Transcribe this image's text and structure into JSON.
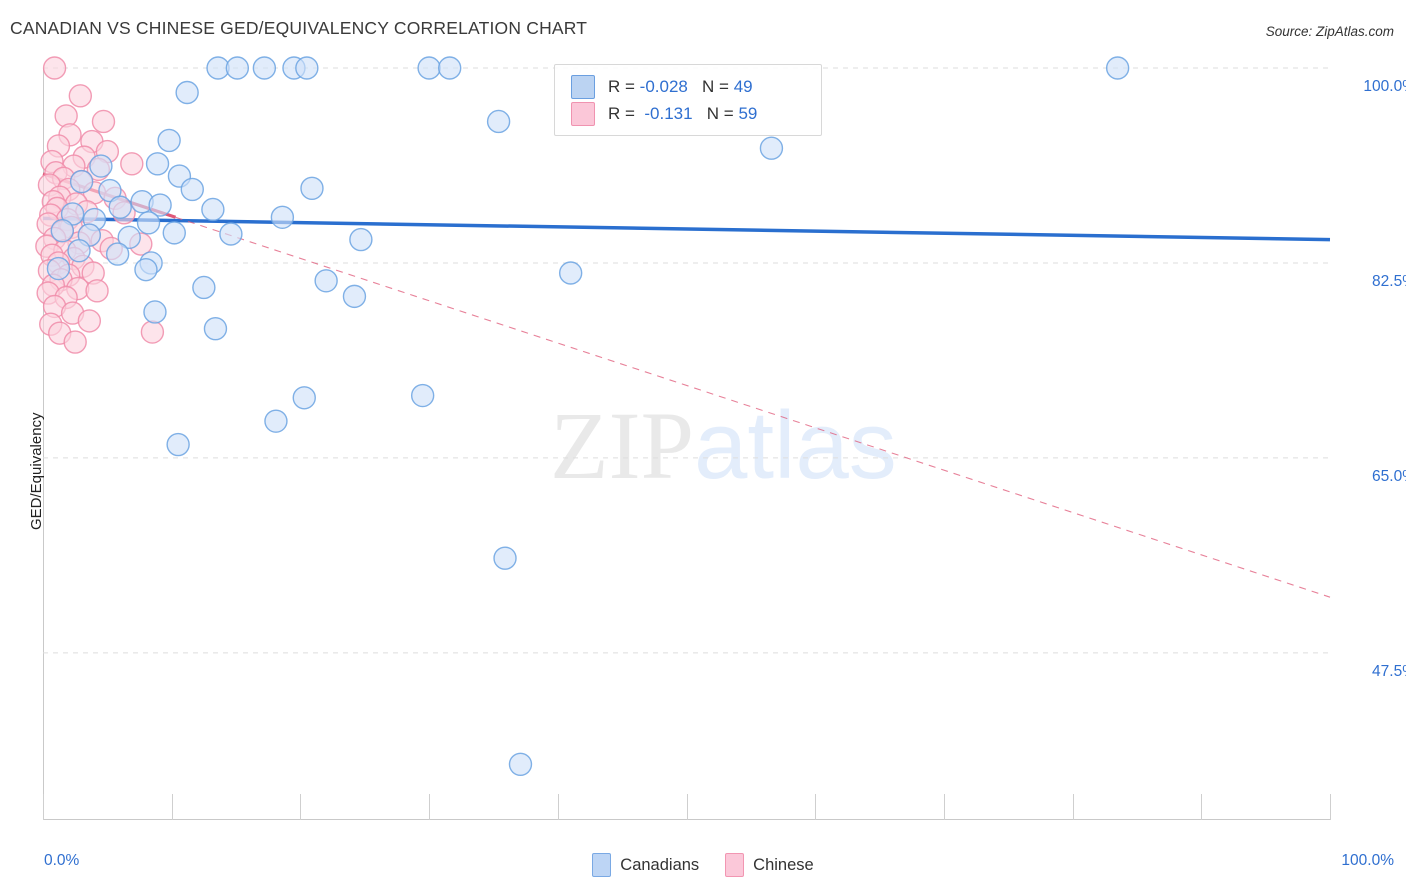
{
  "header": {
    "title": "CANADIAN VS CHINESE GED/EQUIVALENCY CORRELATION CHART",
    "source": "Source: ZipAtlas.com"
  },
  "watermark": {
    "part1": "ZIP",
    "part2": "atlas"
  },
  "axes": {
    "y_label": "GED/Equivalency",
    "y_ticks": [
      "100.0%",
      "82.5%",
      "65.0%",
      "47.5%"
    ],
    "x_min_label": "0.0%",
    "x_max_label": "100.0%"
  },
  "stats_legend": {
    "rows": [
      {
        "color": "#bbd3f2",
        "r_label": "R =",
        "r_value": "-0.028",
        "n_label": "N =",
        "n_value": "49"
      },
      {
        "color": "#fbc7d8",
        "r_label": "R =",
        "r_value": "-0.131",
        "n_label": "N =",
        "n_value": "59"
      }
    ]
  },
  "series_legend": [
    {
      "name": "Canadians",
      "color": "#bdd5f5"
    },
    {
      "name": "Chinese",
      "color": "#fbc8d9"
    }
  ],
  "colors": {
    "blue_fill": "#cfe0f8",
    "blue_stroke": "#6ba3e2",
    "pink_fill": "#fbd3de",
    "pink_stroke": "#f08ca9",
    "blue_trend": "#2a6fcf",
    "pink_trend": "#e05878",
    "axis_text": "#2f6fd0",
    "grid": "#dddddd"
  },
  "chart_data": {
    "type": "scatter",
    "title": "CANADIAN VS CHINESE GED/EQUIVALENCY CORRELATION CHART",
    "xlabel": "",
    "ylabel": "GED/Equivalency",
    "xlim": [
      0,
      100
    ],
    "ylim": [
      32.5,
      100
    ],
    "y_gridlines": [
      100.0,
      82.5,
      65.0,
      47.5
    ],
    "grid": true,
    "legend_position": "bottom-center",
    "series": [
      {
        "name": "Canadians",
        "color": "#cfe0f8",
        "R": -0.028,
        "N": 49,
        "trendline": {
          "style": "solid",
          "x0": 0,
          "y0": 86.5,
          "x1": 100,
          "y1": 84.6
        },
        "points": [
          [
            13.6,
            100.0
          ],
          [
            15.1,
            100.0
          ],
          [
            17.2,
            100.0
          ],
          [
            19.5,
            100.0
          ],
          [
            20.5,
            100.0
          ],
          [
            30.0,
            100.0
          ],
          [
            31.6,
            100.0
          ],
          [
            83.5,
            100.0
          ],
          [
            11.2,
            97.8
          ],
          [
            35.4,
            95.2
          ],
          [
            9.8,
            93.5
          ],
          [
            8.9,
            91.4
          ],
          [
            56.6,
            92.8
          ],
          [
            4.5,
            91.2
          ],
          [
            10.6,
            90.3
          ],
          [
            11.6,
            89.1
          ],
          [
            3.0,
            89.8
          ],
          [
            5.2,
            89.0
          ],
          [
            20.9,
            89.2
          ],
          [
            7.7,
            88.0
          ],
          [
            9.1,
            87.7
          ],
          [
            13.2,
            87.3
          ],
          [
            6.0,
            87.5
          ],
          [
            2.3,
            86.9
          ],
          [
            4.0,
            86.4
          ],
          [
            8.2,
            86.1
          ],
          [
            18.6,
            86.6
          ],
          [
            1.5,
            85.4
          ],
          [
            3.6,
            85.0
          ],
          [
            6.7,
            84.8
          ],
          [
            10.2,
            85.2
          ],
          [
            14.6,
            85.1
          ],
          [
            2.8,
            83.6
          ],
          [
            5.8,
            83.3
          ],
          [
            8.4,
            82.5
          ],
          [
            1.2,
            82.0
          ],
          [
            24.7,
            84.6
          ],
          [
            8.0,
            81.9
          ],
          [
            12.5,
            80.3
          ],
          [
            41.0,
            81.6
          ],
          [
            22.0,
            80.9
          ],
          [
            24.2,
            79.5
          ],
          [
            8.7,
            78.1
          ],
          [
            13.4,
            76.6
          ],
          [
            20.3,
            70.4
          ],
          [
            29.5,
            70.6
          ],
          [
            18.1,
            68.3
          ],
          [
            10.5,
            66.2
          ],
          [
            35.9,
            56.0
          ],
          [
            37.1,
            37.5
          ]
        ]
      },
      {
        "name": "Chinese",
        "color": "#fbd3de",
        "R": -0.131,
        "N": 59,
        "trendline": {
          "style": "solid-then-dashed",
          "x0": 0,
          "y0": 90.5,
          "x_solid_end": 10.3,
          "y_solid_end": 86.6,
          "x1": 100,
          "y1": 52.5
        },
        "points": [
          [
            0.9,
            100.0
          ],
          [
            2.9,
            97.5
          ],
          [
            1.8,
            95.7
          ],
          [
            4.7,
            95.2
          ],
          [
            2.1,
            94.0
          ],
          [
            3.8,
            93.4
          ],
          [
            1.2,
            93.0
          ],
          [
            5.0,
            92.5
          ],
          [
            3.2,
            92.0
          ],
          [
            0.7,
            91.6
          ],
          [
            2.4,
            91.2
          ],
          [
            4.3,
            90.9
          ],
          [
            1.0,
            90.6
          ],
          [
            6.9,
            91.4
          ],
          [
            1.6,
            90.1
          ],
          [
            3.0,
            89.8
          ],
          [
            0.5,
            89.5
          ],
          [
            2.0,
            89.1
          ],
          [
            4.0,
            88.8
          ],
          [
            1.3,
            88.4
          ],
          [
            0.8,
            88.0
          ],
          [
            2.6,
            87.8
          ],
          [
            5.6,
            88.3
          ],
          [
            1.1,
            87.4
          ],
          [
            3.4,
            87.1
          ],
          [
            0.6,
            86.8
          ],
          [
            1.9,
            86.4
          ],
          [
            0.4,
            86.0
          ],
          [
            2.2,
            85.7
          ],
          [
            6.3,
            87.0
          ],
          [
            1.5,
            85.3
          ],
          [
            3.6,
            85.0
          ],
          [
            0.9,
            84.7
          ],
          [
            2.8,
            84.3
          ],
          [
            0.3,
            84.0
          ],
          [
            1.7,
            83.6
          ],
          [
            4.6,
            84.5
          ],
          [
            0.7,
            83.2
          ],
          [
            2.4,
            82.9
          ],
          [
            5.3,
            83.8
          ],
          [
            1.2,
            82.5
          ],
          [
            3.1,
            82.2
          ],
          [
            0.5,
            81.8
          ],
          [
            2.0,
            81.4
          ],
          [
            7.6,
            84.2
          ],
          [
            1.4,
            81.0
          ],
          [
            3.9,
            81.6
          ],
          [
            0.8,
            80.5
          ],
          [
            2.7,
            80.2
          ],
          [
            0.4,
            79.8
          ],
          [
            1.8,
            79.4
          ],
          [
            4.2,
            80.0
          ],
          [
            0.9,
            78.6
          ],
          [
            2.3,
            78.0
          ],
          [
            3.6,
            77.3
          ],
          [
            0.6,
            77.0
          ],
          [
            1.3,
            76.2
          ],
          [
            8.5,
            76.3
          ],
          [
            2.5,
            75.4
          ]
        ]
      }
    ]
  }
}
